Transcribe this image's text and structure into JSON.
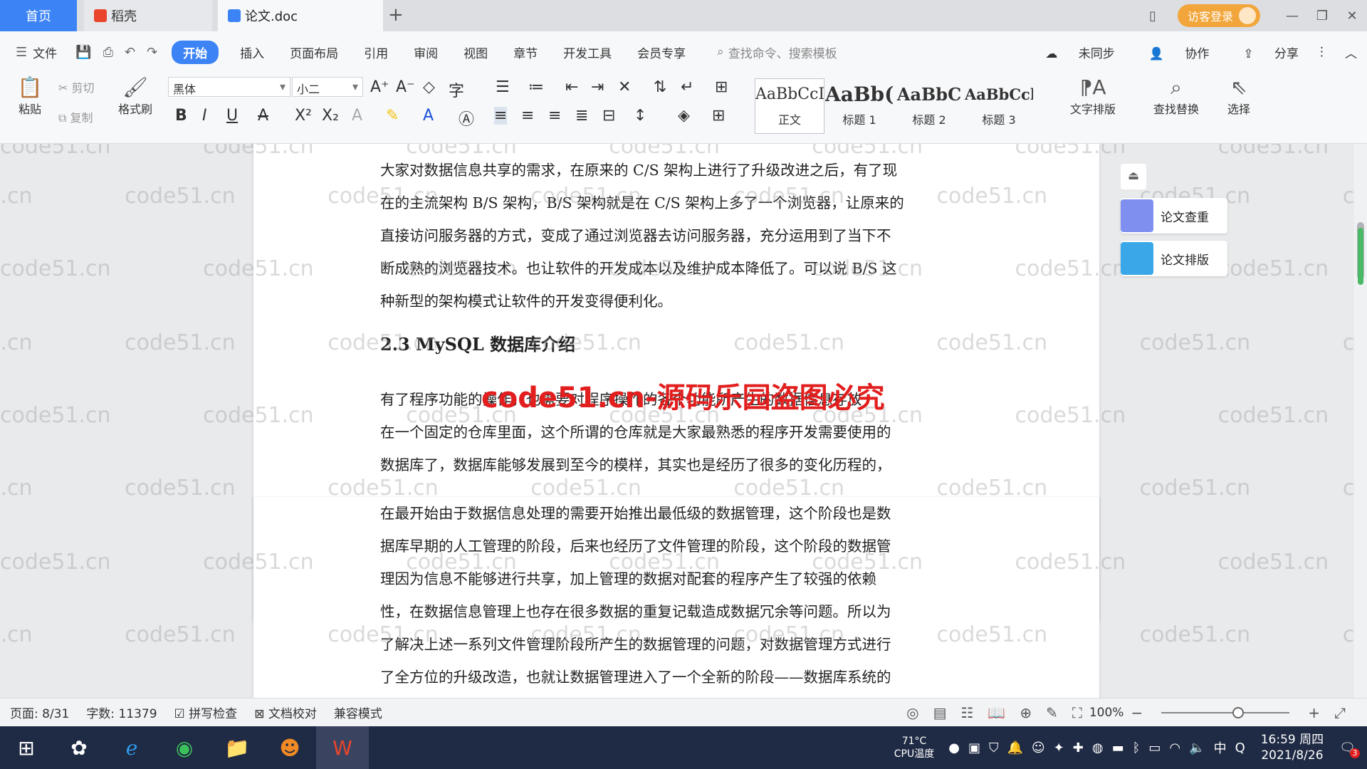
{
  "tabs": {
    "home": "首页",
    "daoke": "稻壳",
    "document": "论文.doc",
    "new_tab": "+"
  },
  "titlebar": {
    "login": "访客登录",
    "minimize": "—",
    "restore": "❐",
    "close": "✕"
  },
  "menu": {
    "file": "文件",
    "items": [
      "开始",
      "插入",
      "页面布局",
      "引用",
      "审阅",
      "视图",
      "章节",
      "开发工具",
      "会员专享"
    ],
    "search_placeholder": "查找命令、搜索模板",
    "unsynced": "未同步",
    "collaborate": "协作",
    "share": "分享"
  },
  "ribbon": {
    "paste": "粘贴",
    "cut": "剪切",
    "copy": "复制",
    "format_painter": "格式刷",
    "font_name": "黑体",
    "font_size": "小二",
    "styles": [
      {
        "preview": "AaBbCcI",
        "label": "正文"
      },
      {
        "preview": "AaBb(",
        "label": "标题 1"
      },
      {
        "preview": "AaBbC",
        "label": "标题 2"
      },
      {
        "preview": "AaBbCcl",
        "label": "标题 3"
      }
    ],
    "text_layout": "文字排版",
    "find_replace": "查找替换",
    "select": "选择"
  },
  "document": {
    "para1_lines": [
      "大家对数据信息共享的需求，在原来的 C/S 架构上进行了升级改进之后，有了现",
      "在的主流架构 B/S 架构，B/S 架构就是在 C/S 架构上多了一个浏览器，让原来的",
      "直接访问服务器的方式，变成了通过浏览器去访问服务器，充分运用到了当下不",
      "断成熟的浏览器技术。也让软件的开发成本以及维护成本降低了。可以说 B/S 这",
      "种新型的架构模式让软件的开发变得便利化。"
    ],
    "heading": "2.3 MySQL 数据库介绍",
    "para2_lines": [
      "    有了程序功能的操作，也需要对程序操作的各个功能所产生的数据信息存放",
      "在一个固定的仓库里面，这个所谓的仓库就是大家最熟悉的程序开发需要使用的",
      "数据库了，数据库能够发展到至今的模样，其实也是经历了很多的变化历程的，",
      "在最开始由于数据信息处理的需要开始推出最低级的数据管理，这个阶段也是数",
      "据库早期的人工管理的阶段，后来也经历了文件管理的阶段，这个阶段的数据管",
      "理因为信息不能够进行共享，加上管理的数据对配套的程序产生了较强的依赖",
      "性，在数据信息管理上也存在很多数据的重复记载造成数据冗余等问题。所以为",
      "了解决上述一系列文件管理阶段所产生的数据管理的问题，对数据管理方式进行",
      "了全方位的升级改造，也就让数据管理进入了一个全新的阶段——数据库系统的"
    ],
    "watermark": "code51.cn",
    "stamp": "code51.cn-源码乐园盗图必究"
  },
  "side_tools": {
    "check": "论文查重",
    "layout": "论文排版"
  },
  "status": {
    "page": "页面: 8/31",
    "words": "字数: 11379",
    "spellcheck": "拼写检查",
    "proofread": "文档校对",
    "compat": "兼容模式",
    "zoom": "100%",
    "zoom_level": 0.5
  },
  "taskbar": {
    "cpu_temp": "71°C",
    "cpu_label": "CPU温度",
    "ime": "中",
    "time": "16:59 周四",
    "date": "2021/8/26",
    "notif_count": "3"
  },
  "colors": {
    "accent": "#3c84f6",
    "login": "#f2a53a",
    "stamp": "#e21e1e"
  }
}
